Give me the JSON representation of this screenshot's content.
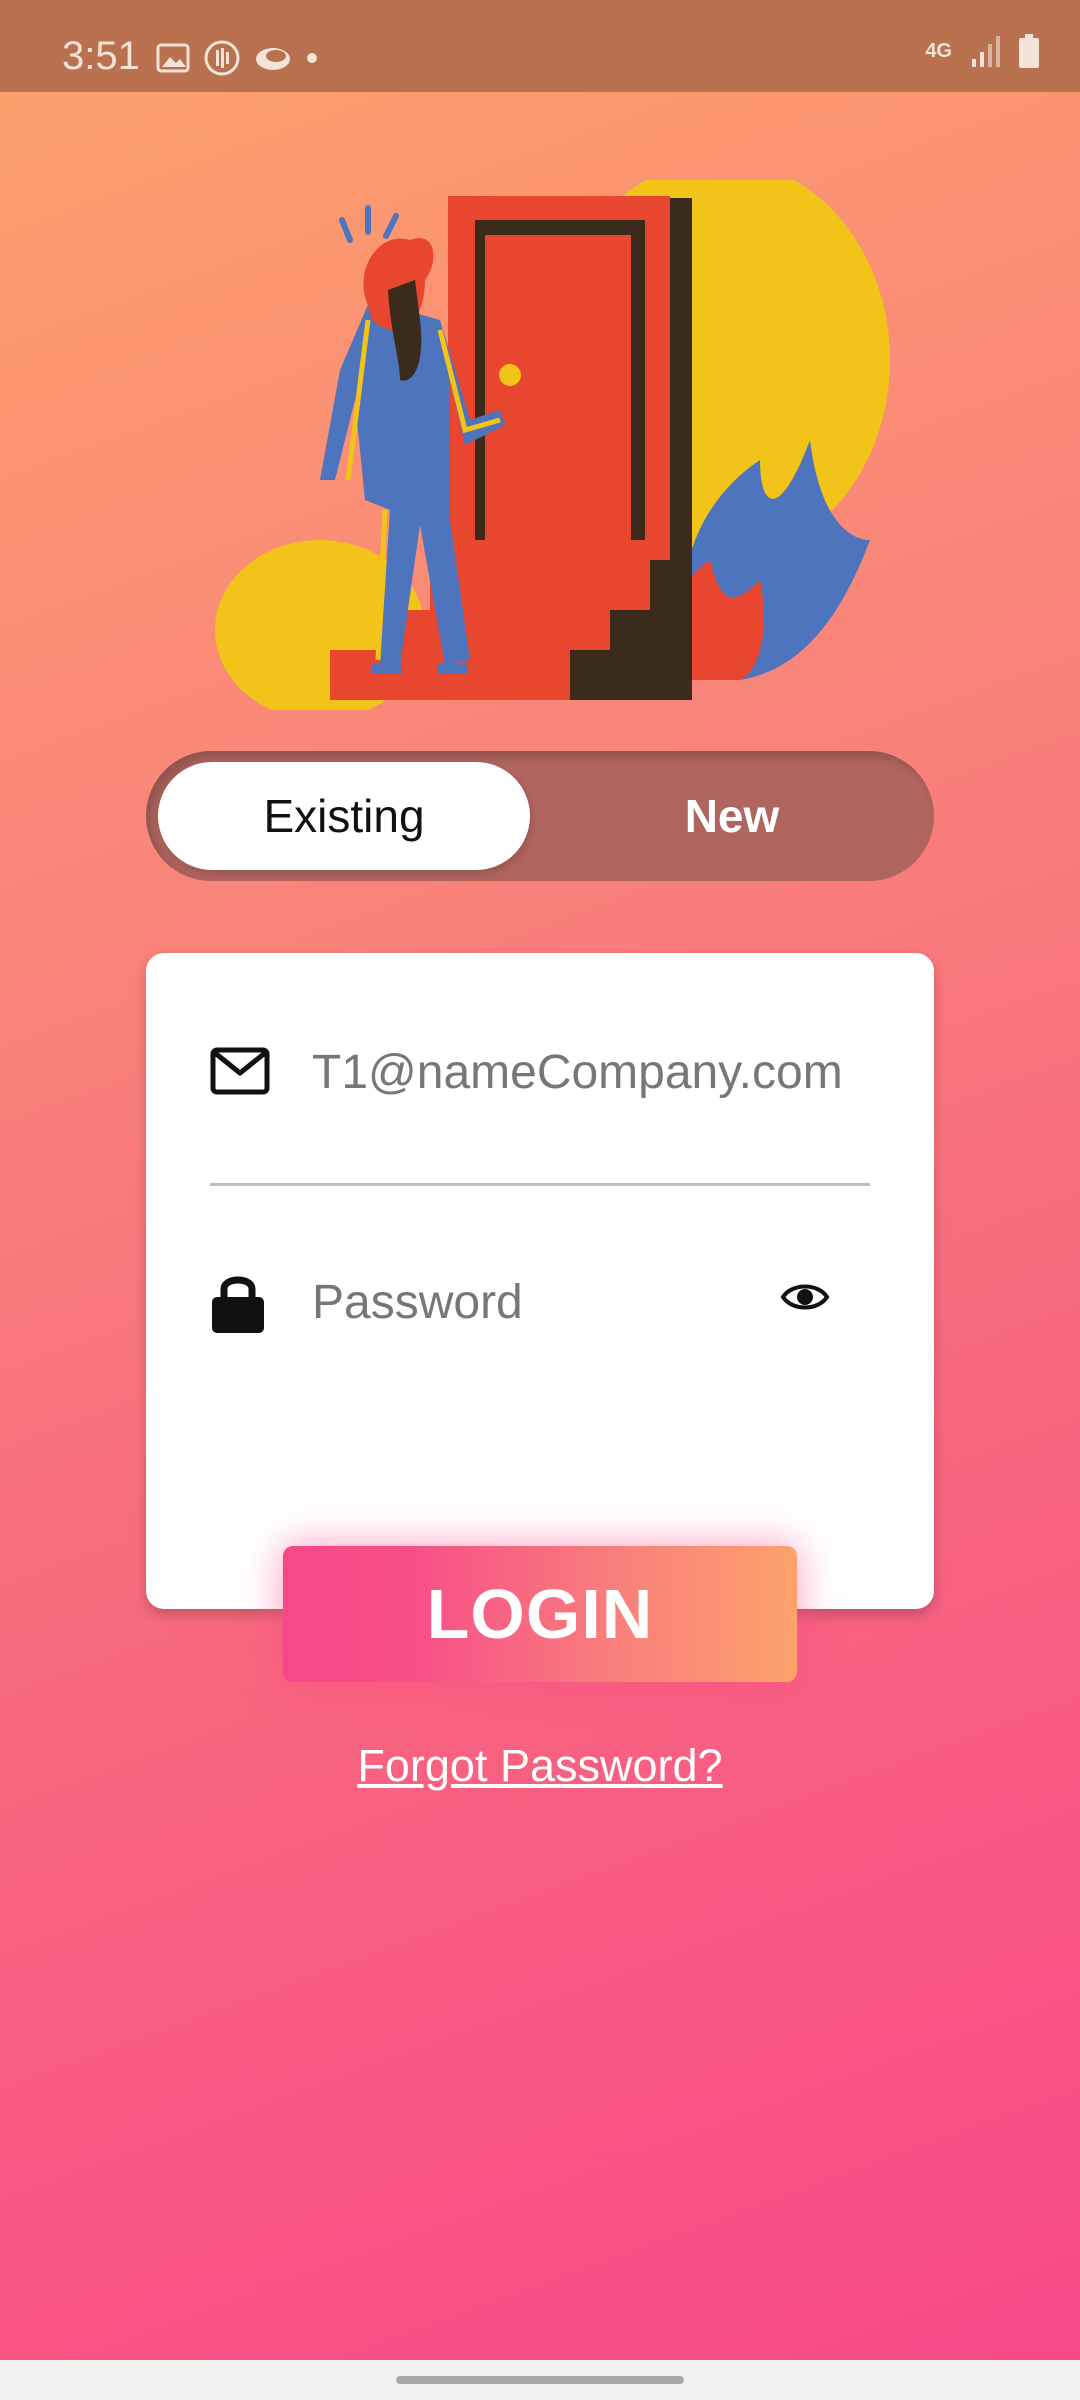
{
  "status_bar": {
    "time": "3:51",
    "network": "4G",
    "left_icons": [
      "gallery-icon",
      "podcast-icon",
      "cloud-icon",
      "dot-icon"
    ],
    "right_icons": [
      "signal-icon",
      "battery-icon"
    ]
  },
  "illustration": {
    "name": "person-at-door-illustration"
  },
  "toggle": {
    "existing_label": "Existing",
    "new_label": "New",
    "selected": "Existing"
  },
  "form": {
    "email_placeholder": "T1@nameCompany.com",
    "password_placeholder": "Password",
    "email_icon": "envelope-icon",
    "password_icon": "lock-icon",
    "visibility_icon": "eye-icon"
  },
  "actions": {
    "login_label": "LOGIN",
    "forgot_label": "Forgot Password?"
  },
  "colors": {
    "gradient_top": "#FCA26B",
    "gradient_bottom": "#F74789",
    "status_bar": "#B9714F",
    "toggle_track": "#B1655F"
  }
}
